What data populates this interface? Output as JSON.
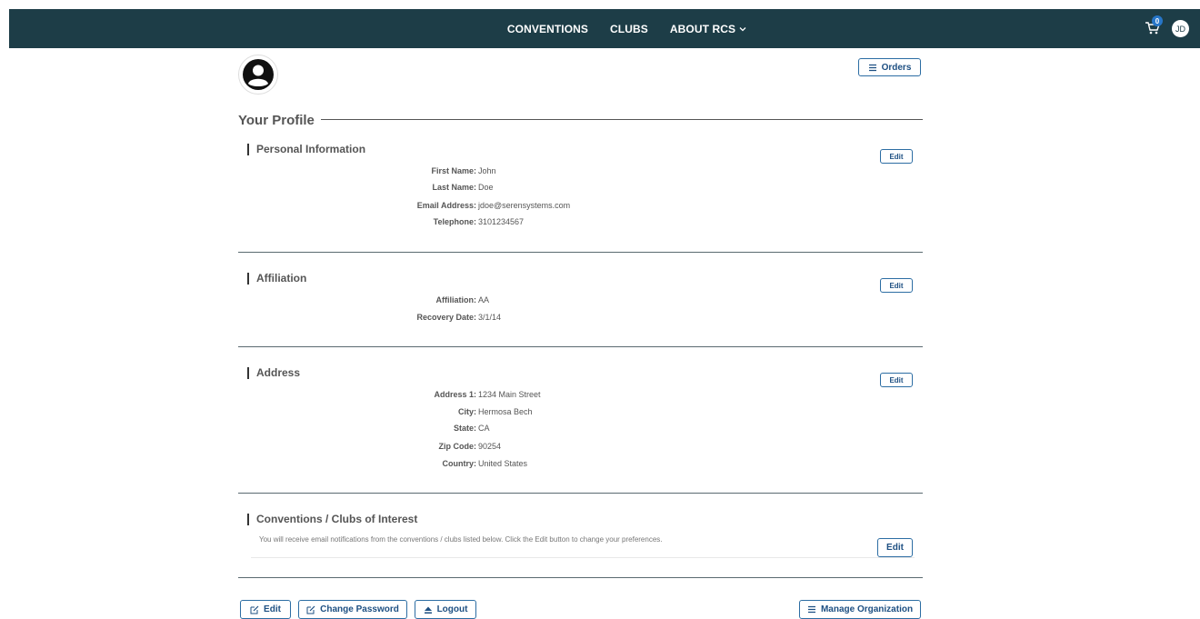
{
  "nav": {
    "links": [
      "CONVENTIONS",
      "CLUBS",
      "ABOUT RCS"
    ],
    "cart_count": "0",
    "user_initials": "JD"
  },
  "orders_button": "Orders",
  "page_title": "Your Profile",
  "sections": {
    "personal": {
      "title": "Personal Information",
      "edit": "Edit",
      "fields": [
        {
          "label": "First Name:",
          "value": "John"
        },
        {
          "label": "Last Name:",
          "value": "Doe"
        },
        {
          "label": "Email Address:",
          "value": "jdoe@serensystems.com"
        },
        {
          "label": "Telephone:",
          "value": "3101234567"
        }
      ]
    },
    "affiliation": {
      "title": "Affiliation",
      "edit": "Edit",
      "fields": [
        {
          "label": "Affiliation:",
          "value": "AA"
        },
        {
          "label": "Recovery Date:",
          "value": "3/1/14"
        }
      ]
    },
    "address": {
      "title": "Address",
      "edit": "Edit",
      "fields": [
        {
          "label": "Address 1:",
          "value": "1234 Main Street"
        },
        {
          "label": "City:",
          "value": "Hermosa Bech"
        },
        {
          "label": "State:",
          "value": "CA"
        },
        {
          "label": "Zip Code:",
          "value": "90254"
        },
        {
          "label": "Country:",
          "value": "United States"
        }
      ]
    },
    "interests": {
      "title": "Conventions / Clubs of Interest",
      "note": "You will receive email notifications from the conventions / clubs listed below. Click the Edit button to change your preferences.",
      "edit": "Edit"
    }
  },
  "footer": {
    "edit": "Edit",
    "change_password": "Change Password",
    "logout": "Logout",
    "manage_org": "Manage Organization"
  },
  "colors": {
    "nav_bg": "#1d3d47",
    "accent": "#2c6da3",
    "badge": "#2776c8"
  }
}
